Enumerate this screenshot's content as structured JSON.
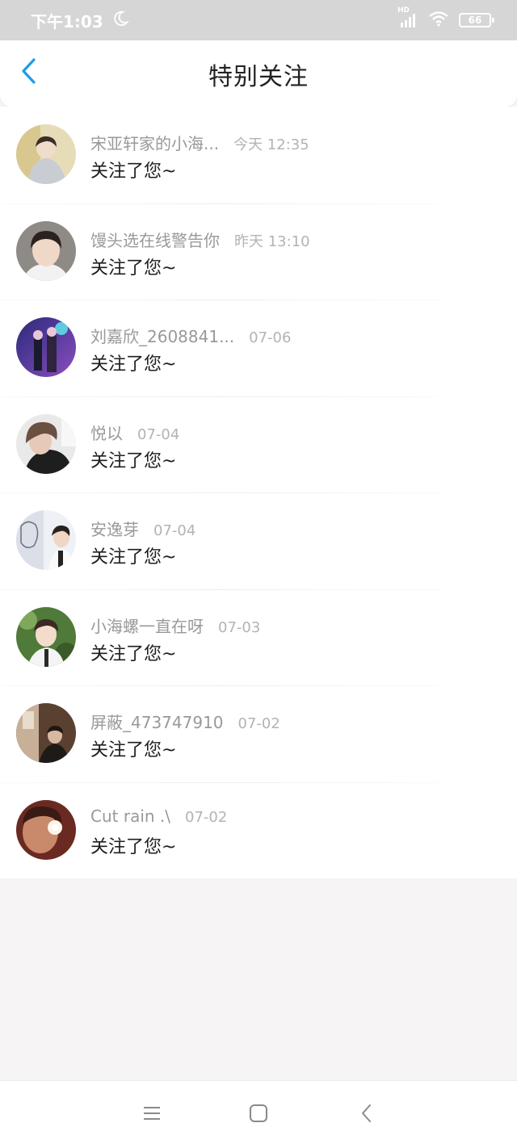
{
  "status_bar": {
    "time": "下午1:03",
    "hd": "HD",
    "battery": "66",
    "icons": [
      "moon-icon",
      "signal-icon",
      "wifi-icon",
      "battery-icon"
    ]
  },
  "nav": {
    "title": "特别关注",
    "back_icon": "chevron-left-icon",
    "accent": "#1e9bf0"
  },
  "list": {
    "items": [
      {
        "name": "宋亚轩家的小海...",
        "time": "今天 12:35",
        "message": "关注了您~",
        "avatar": "avatar-1"
      },
      {
        "name": "馒头选在线警告你",
        "time": "昨天 13:10",
        "message": "关注了您~",
        "avatar": "avatar-2"
      },
      {
        "name": "刘嘉欣_2608841...",
        "time": "07-06",
        "message": "关注了您~",
        "avatar": "avatar-3"
      },
      {
        "name": "悦以",
        "time": "07-04",
        "message": "关注了您~",
        "avatar": "avatar-4"
      },
      {
        "name": "安逸芽",
        "time": "07-04",
        "message": "关注了您~",
        "avatar": "avatar-5"
      },
      {
        "name": "小海螺一直在呀",
        "time": "07-03",
        "message": "关注了您~",
        "avatar": "avatar-6"
      },
      {
        "name": "屏蔽_473747910",
        "time": "07-02",
        "message": "关注了您~",
        "avatar": "avatar-7"
      },
      {
        "name": "Cut rain .\\",
        "time": "07-02",
        "message": "关注了您~",
        "avatar": "avatar-8"
      }
    ]
  },
  "system_nav": {
    "icons": [
      "menu-icon",
      "home-icon",
      "back-icon"
    ]
  }
}
